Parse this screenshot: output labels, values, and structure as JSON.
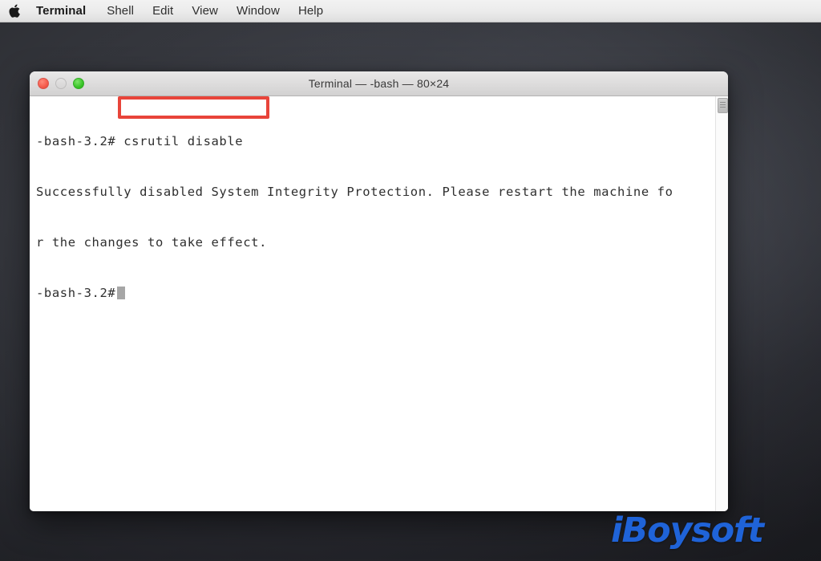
{
  "menubar": {
    "apple_icon": "apple-logo-icon",
    "items": [
      {
        "label": "Terminal",
        "bold": true
      },
      {
        "label": "Shell",
        "bold": false
      },
      {
        "label": "Edit",
        "bold": false
      },
      {
        "label": "View",
        "bold": false
      },
      {
        "label": "Window",
        "bold": false
      },
      {
        "label": "Help",
        "bold": false
      }
    ]
  },
  "terminal_window": {
    "title": "Terminal — -bash — 80×24",
    "controls": {
      "close": "close-button",
      "minimize": "minimize-button",
      "maximize": "maximize-button"
    },
    "lines": [
      "-bash-3.2# csrutil disable",
      "Successfully disabled System Integrity Protection. Please restart the machine fo",
      "r the changes to take effect.",
      "-bash-3.2# "
    ],
    "prompt": "-bash-3.2#",
    "command": "csrutil disable",
    "cursor": "block-cursor"
  },
  "annotation": {
    "highlight_target": "csrutil disable",
    "color": "#e8443a"
  },
  "watermark": {
    "text": "iBoysoft",
    "color": "#1f63d8"
  },
  "colors": {
    "desktop_background": "#3a3c43",
    "menubar_background": "#ebebeb",
    "terminal_background": "#ffffff",
    "terminal_text": "#2f2f2f",
    "close_button": "#f4594a",
    "minimize_button": "#d6d5d5",
    "maximize_button": "#38c326"
  }
}
